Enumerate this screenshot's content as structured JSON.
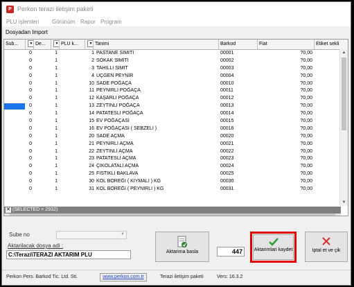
{
  "window": {
    "title": "Perkon terazi iletişim paketi"
  },
  "menu": [
    "PLU işlemleri",
    "Görünüm",
    "Rapor",
    "Program"
  ],
  "subtitle": "Dosyadan Import",
  "columns": [
    "Sub...",
    "De...",
    "PLU k...",
    "Tanimi",
    "Barkod",
    "Fiat",
    "Etiket sekli"
  ],
  "rows": [
    {
      "sube": "0",
      "de": "1",
      "plu": "1",
      "tanimi": "PASTANE SİMİTİ",
      "barkod": "00001",
      "fiat": "?0,00"
    },
    {
      "sube": "0",
      "de": "1",
      "plu": "2",
      "tanimi": "SOKAK SİMİTİ",
      "barkod": "00002",
      "fiat": "?0,00"
    },
    {
      "sube": "0",
      "de": "1",
      "plu": "3",
      "tanimi": "TAHILLI SİMİT",
      "barkod": "00003",
      "fiat": "?0,00"
    },
    {
      "sube": "0",
      "de": "1",
      "plu": "4",
      "tanimi": "ÜÇGEN PEYNİR",
      "barkod": "00004",
      "fiat": "?0,00"
    },
    {
      "sube": "0",
      "de": "1",
      "plu": "10",
      "tanimi": "SADE POĞAÇA",
      "barkod": "00010",
      "fiat": "?0,00"
    },
    {
      "sube": "0",
      "de": "1",
      "plu": "11",
      "tanimi": "PEYNİRLİ POĞAÇA",
      "barkod": "00011",
      "fiat": "?0,00"
    },
    {
      "sube": "0",
      "de": "1",
      "plu": "12",
      "tanimi": "KAŞARLI POĞAÇA",
      "barkod": "00012",
      "fiat": "?0,00"
    },
    {
      "sube": "0",
      "de": "1",
      "plu": "13",
      "tanimi": "ZEYTİNLİ POĞAÇA",
      "barkod": "00013",
      "fiat": "?0,00"
    },
    {
      "sube": "0",
      "de": "1",
      "plu": "14",
      "tanimi": "PATATESLİ POĞAÇA",
      "barkod": "00014",
      "fiat": "?0,00"
    },
    {
      "sube": "0",
      "de": "1",
      "plu": "15",
      "tanimi": "EV POĞAÇASI",
      "barkod": "00015",
      "fiat": "?0,00"
    },
    {
      "sube": "0",
      "de": "1",
      "plu": "16",
      "tanimi": "EV POĞAÇASI ( SEBZELİ )",
      "barkod": "00016",
      "fiat": "?0,00"
    },
    {
      "sube": "0",
      "de": "1",
      "plu": "20",
      "tanimi": "SADE AÇMA",
      "barkod": "00020",
      "fiat": "?0,00"
    },
    {
      "sube": "0",
      "de": "1",
      "plu": "21",
      "tanimi": "PEYNİRLİ AÇMA",
      "barkod": "00021",
      "fiat": "?0,00"
    },
    {
      "sube": "0",
      "de": "1",
      "plu": "22",
      "tanimi": "ZEYTİNLİ AÇMA",
      "barkod": "00022",
      "fiat": "?0,00"
    },
    {
      "sube": "0",
      "de": "1",
      "plu": "23",
      "tanimi": "PATATESLİ AÇMA",
      "barkod": "00023",
      "fiat": "?0,00"
    },
    {
      "sube": "0",
      "de": "1",
      "plu": "24",
      "tanimi": "ÇİKOLATALI AÇMA",
      "barkod": "00024",
      "fiat": "?0,00"
    },
    {
      "sube": "0",
      "de": "1",
      "plu": "25",
      "tanimi": "FISTIKLI BAKLAVA",
      "barkod": "00025",
      "fiat": "?0,00"
    },
    {
      "sube": "0",
      "de": "1",
      "plu": "30",
      "tanimi": "KOL BÖREĞİ ( KIYMALI ) KG",
      "barkod": "00030",
      "fiat": "?0,00"
    },
    {
      "sube": "0",
      "de": "1",
      "plu": "31",
      "tanimi": "KOL BÖREĞİ ( PEYNİRLİ ) KG",
      "barkod": "00031",
      "fiat": "?0,00"
    }
  ],
  "grid_footer": "(SELECTED = 2932)",
  "sube_label": "Sube no",
  "path_label": "Aktarilacak dosya adi :",
  "path_value": "C:\\Terazi\\TERAZI AKTARIM PLU",
  "start_button": "Aktarima basla",
  "count": "447",
  "save_button": "Aktarimlari kaydet",
  "cancel_button": "Iptal et ve çik",
  "status": {
    "company": "Perkon Pers. Barkod Tic. Ltd. Sti.",
    "website": "www.perkon.com.tr",
    "app": "Terazi iletişim paketi",
    "version": "Vers: 16.3.2"
  },
  "colors": {
    "highlight": "#e00000",
    "selection": "#1a73e8",
    "link": "#1a3fbf"
  }
}
